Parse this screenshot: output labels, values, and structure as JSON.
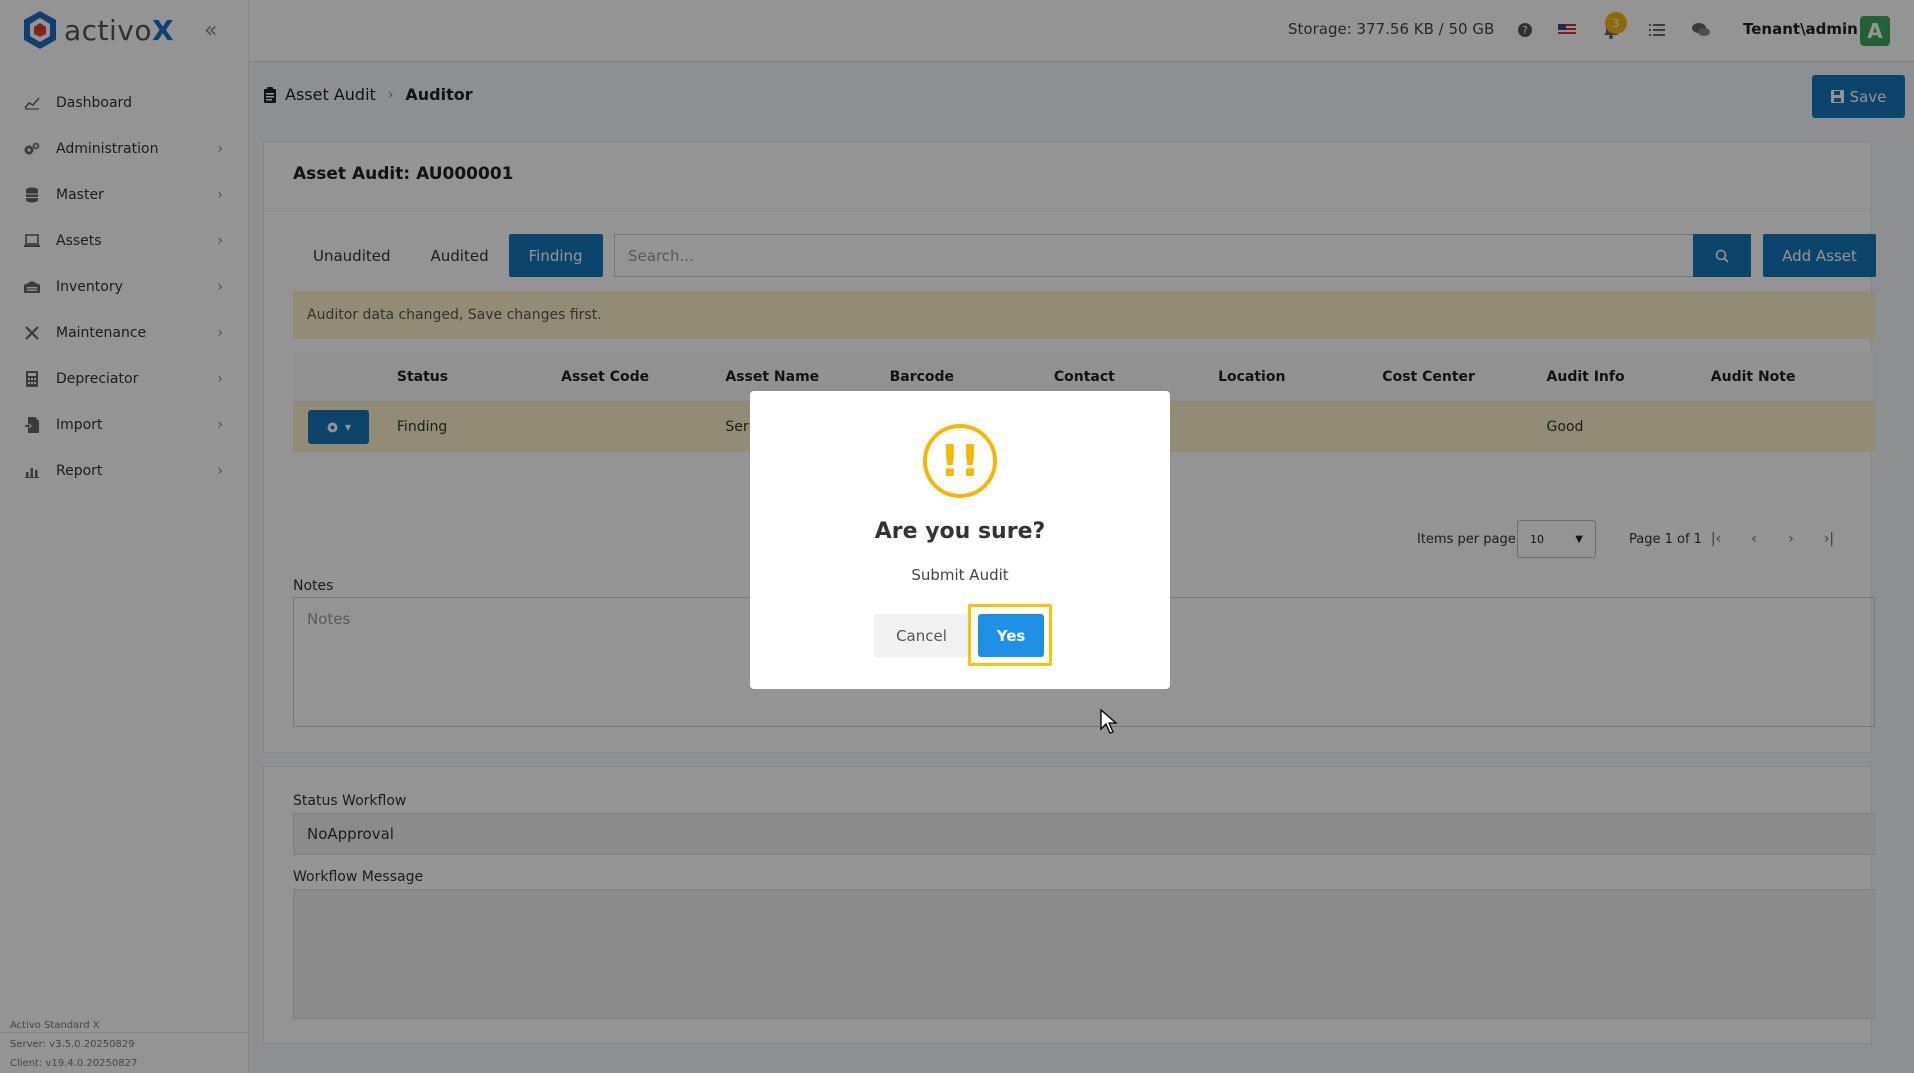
{
  "app": {
    "logo_prefix": "activo",
    "logo_suffix": "X"
  },
  "sidebar": {
    "items": [
      {
        "label": "Dashboard",
        "icon": "chart-icon",
        "has_children": false
      },
      {
        "label": "Administration",
        "icon": "gears-icon",
        "has_children": true
      },
      {
        "label": "Master",
        "icon": "database-icon",
        "has_children": true
      },
      {
        "label": "Assets",
        "icon": "laptop-icon",
        "has_children": true
      },
      {
        "label": "Inventory",
        "icon": "warehouse-icon",
        "has_children": true
      },
      {
        "label": "Maintenance",
        "icon": "tools-icon",
        "has_children": true
      },
      {
        "label": "Depreciator",
        "icon": "calculator-icon",
        "has_children": true
      },
      {
        "label": "Import",
        "icon": "file-import-icon",
        "has_children": true
      },
      {
        "label": "Report",
        "icon": "report-chart-icon",
        "has_children": true
      }
    ],
    "footer": {
      "product": "Activo Standard X",
      "server": "Server: v3.5.0.20250829",
      "client": "Client: v19.4.0.20250827"
    }
  },
  "topbar": {
    "storage": "Storage: 377.56 KB / 50 GB",
    "notification_count": "3",
    "user": "Tenant\\admin",
    "avatar_letter": "A"
  },
  "header": {
    "breadcrumb_root": "Asset Audit",
    "breadcrumb_current": "Auditor",
    "save_label": "Save"
  },
  "panel": {
    "title": "Asset Audit: AU000001",
    "tabs": [
      "Unaudited",
      "Audited",
      "Finding"
    ],
    "active_tab": "Finding",
    "search_placeholder": "Search...",
    "add_asset_label": "Add Asset",
    "alert": "Auditor data changed, Save changes first.",
    "columns": [
      "Status",
      "Asset Code",
      "Asset Name",
      "Barcode",
      "Contact",
      "Location",
      "Cost Center",
      "Audit Info",
      "Audit Note"
    ],
    "rows": [
      {
        "status": "Finding",
        "asset_code": "",
        "asset_name": "Ser",
        "barcode": "",
        "contact": "",
        "location": "",
        "cost_center": "",
        "audit_info": "Good",
        "audit_note": ""
      }
    ],
    "items_per_page_label": "Items per page",
    "items_per_page": "10",
    "page_info": "Page 1 of 1",
    "notes_label": "Notes",
    "notes_placeholder": "Notes"
  },
  "workflow": {
    "status_label": "Status Workflow",
    "status_value": "NoApproval",
    "message_label": "Workflow Message"
  },
  "modal": {
    "title": "Are you sure?",
    "text": "Submit Audit",
    "cancel": "Cancel",
    "confirm": "Yes"
  },
  "colors": {
    "primary": "#1677b8",
    "warning": "#f5b700",
    "alert_bg": "#fdf1c8",
    "confirm": "#1e90e6"
  }
}
